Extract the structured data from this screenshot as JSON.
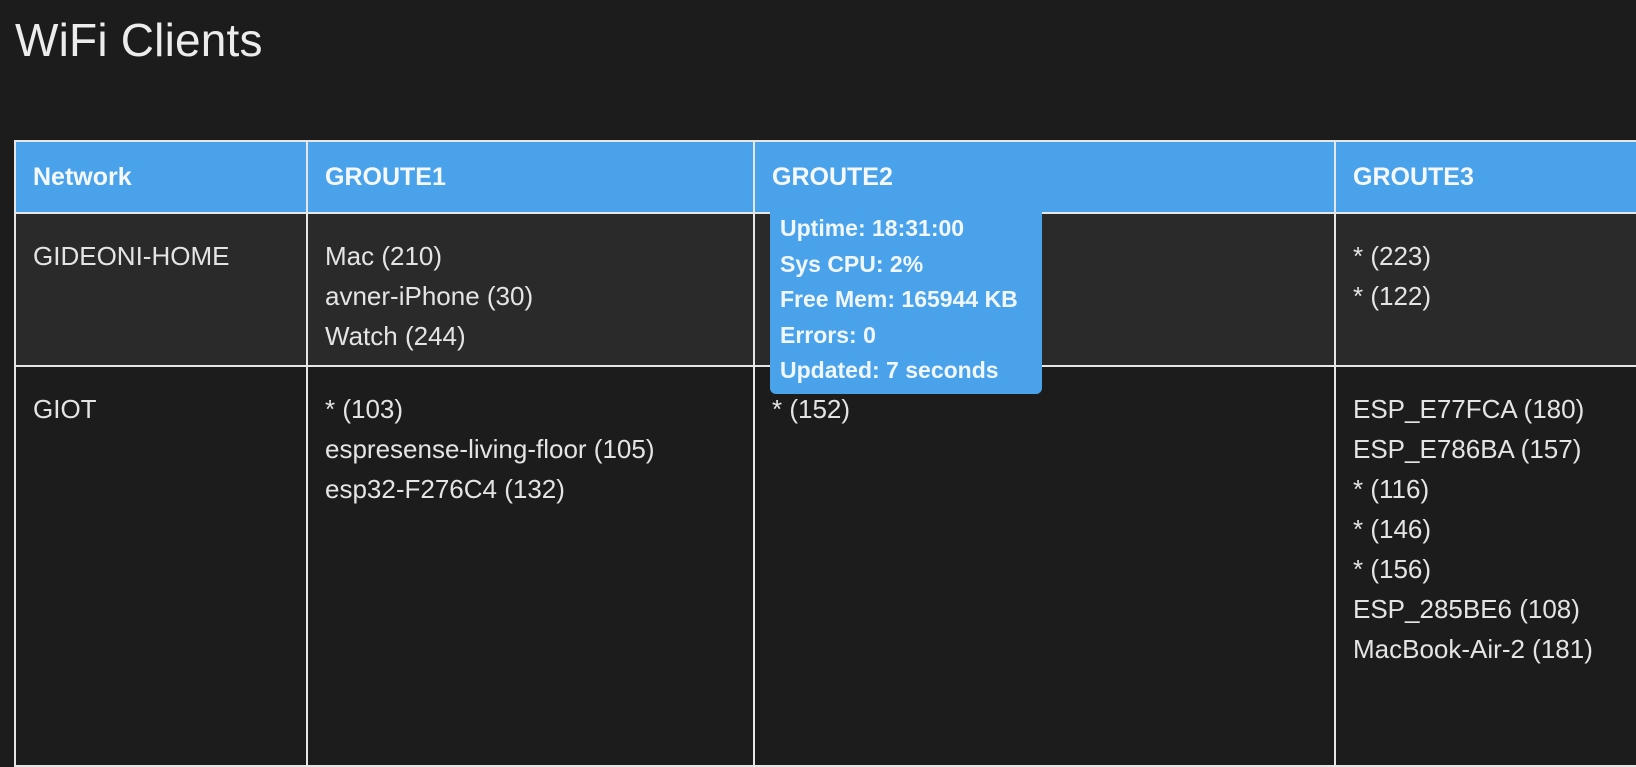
{
  "page": {
    "title": "WiFi Clients"
  },
  "table": {
    "headers": [
      "Network",
      "GROUTE1",
      "GROUTE2",
      "GROUTE3"
    ],
    "rows": [
      {
        "network": "GIDEONI-HOME",
        "groute1": [
          "Mac (210)",
          "avner-iPhone (30)",
          "Watch (244)"
        ],
        "groute2": [],
        "groute3": [
          "* (223)",
          "* (122)"
        ]
      },
      {
        "network": "GIOT",
        "groute1": [
          "* (103)",
          "espresense-living-floor (105)",
          "esp32-F276C4 (132)"
        ],
        "groute2": [
          "* (152)"
        ],
        "groute3": [
          "ESP_E77FCA (180)",
          "ESP_E786BA (157)",
          "* (116)",
          "* (146)",
          "* (156)",
          "ESP_285BE6 (108)",
          "MacBook-Air-2 (181)"
        ]
      }
    ]
  },
  "tooltip": {
    "uptime": "Uptime: 18:31:00",
    "sys_cpu": "Sys CPU: 2%",
    "free_mem": "Free Mem: 165944 KB",
    "errors": "Errors: 0",
    "updated": "Updated: 7 seconds"
  },
  "colors": {
    "background": "#1c1c1c",
    "header_accent": "#4aa3ea",
    "row_alt": "#2a2a2a",
    "grid_line": "#e6e6e6"
  }
}
